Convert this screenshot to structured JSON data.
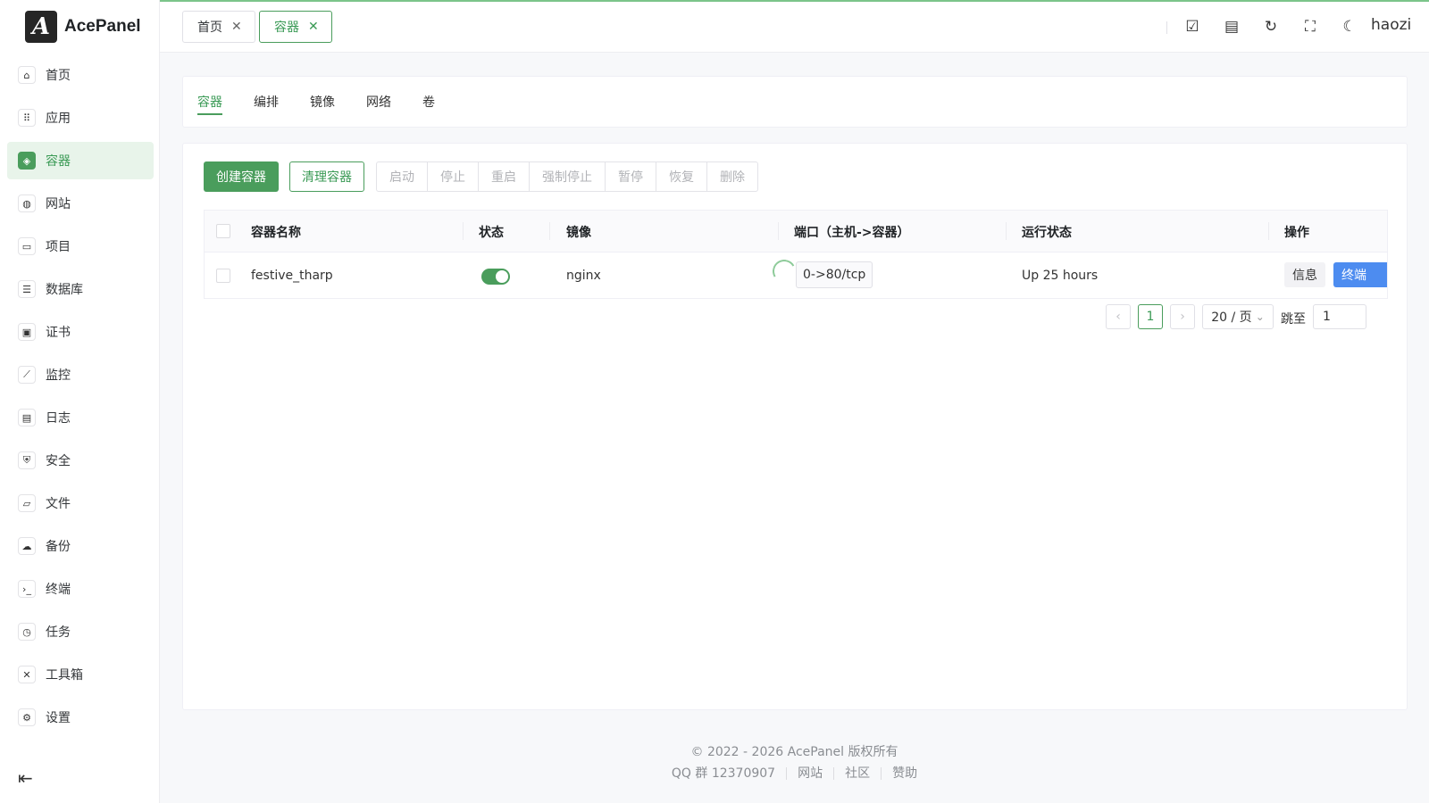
{
  "app": {
    "name": "AcePanel",
    "logo_glyph": "A"
  },
  "sidebar": {
    "items": [
      {
        "label": "首页",
        "icon": "⌂",
        "icon_name": "home-icon"
      },
      {
        "label": "应用",
        "icon": "⠿",
        "icon_name": "apps-icon"
      },
      {
        "label": "容器",
        "icon": "◈",
        "icon_name": "container-icon",
        "active": true
      },
      {
        "label": "网站",
        "icon": "◍",
        "icon_name": "globe-icon"
      },
      {
        "label": "项目",
        "icon": "▭",
        "icon_name": "project-icon"
      },
      {
        "label": "数据库",
        "icon": "☰",
        "icon_name": "database-icon"
      },
      {
        "label": "证书",
        "icon": "▣",
        "icon_name": "certificate-icon"
      },
      {
        "label": "监控",
        "icon": "⟋",
        "icon_name": "monitor-chart-icon"
      },
      {
        "label": "日志",
        "icon": "▤",
        "icon_name": "log-file-icon"
      },
      {
        "label": "安全",
        "icon": "⛨",
        "icon_name": "shield-icon"
      },
      {
        "label": "文件",
        "icon": "▱",
        "icon_name": "folder-icon"
      },
      {
        "label": "备份",
        "icon": "☁",
        "icon_name": "cloud-backup-icon"
      },
      {
        "label": "终端",
        "icon": "›_",
        "icon_name": "terminal-icon"
      },
      {
        "label": "任务",
        "icon": "◷",
        "icon_name": "task-icon"
      },
      {
        "label": "工具箱",
        "icon": "✕",
        "icon_name": "toolbox-icon"
      },
      {
        "label": "设置",
        "icon": "⚙",
        "icon_name": "gear-icon"
      }
    ],
    "collapse_icon": "⇤"
  },
  "header": {
    "tabs": [
      {
        "label": "首页",
        "close": "✕"
      },
      {
        "label": "容器",
        "close": "✕",
        "active": true
      }
    ],
    "icons": {
      "todo": "☑",
      "doc": "▤",
      "refresh": "↻",
      "fullscreen": "⛶",
      "theme": "☾"
    },
    "user": "haozi"
  },
  "subtabs": [
    "容器",
    "编排",
    "镜像",
    "网络",
    "卷"
  ],
  "toolbar": {
    "create": "创建容器",
    "clean": "清理容器",
    "group": [
      "启动",
      "停止",
      "重启",
      "强制停止",
      "暂停",
      "恢复",
      "删除"
    ]
  },
  "table": {
    "headers": {
      "name": "容器名称",
      "status": "状态",
      "image": "镜像",
      "ports": "端口（主机->容器）",
      "run_state": "运行状态",
      "actions": "操作"
    },
    "rows": [
      {
        "name": "festive_tharp",
        "enabled": true,
        "image": "nginx",
        "ports": "0->80/tcp",
        "run_state": "Up 25 hours",
        "info_label": "信息",
        "terminal_label": "终端"
      }
    ]
  },
  "pagination": {
    "prev": "‹",
    "current_page": "1",
    "next": "›",
    "page_size": "20 / 页",
    "page_size_caret": "⌄",
    "jump_label": "跳至",
    "jump_value": "1"
  },
  "footer": {
    "copyright": "© 2022 - 2026 AcePanel 版权所有",
    "qq": "QQ 群 12370907",
    "links": [
      "网站",
      "社区",
      "赞助"
    ]
  },
  "colors": {
    "accent": "#4a9d5c",
    "accent_text": "#3a9a55",
    "terminal_button": "#4d8cf0"
  }
}
